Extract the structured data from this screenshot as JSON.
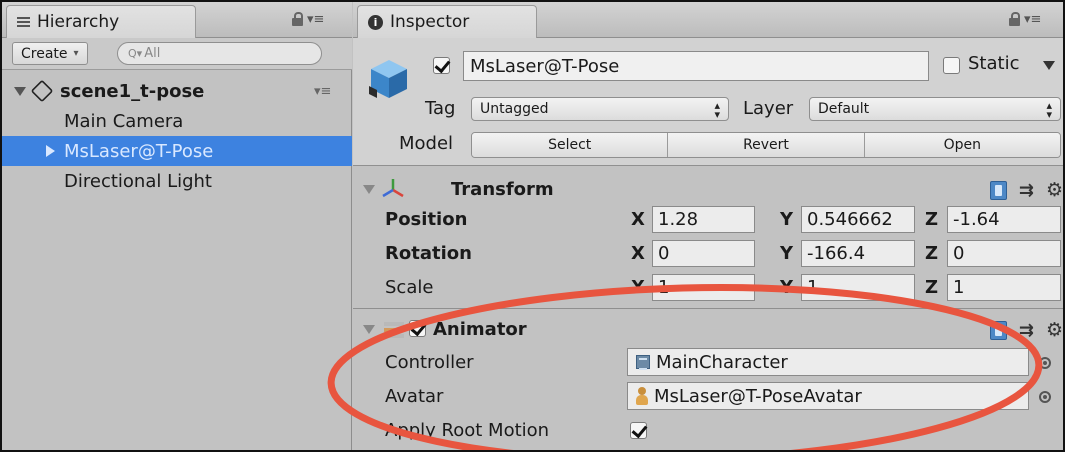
{
  "hierarchy": {
    "tab_label": "Hierarchy",
    "create_label": "Create",
    "search_placeholder": "All",
    "scene_name": "scene1_t-pose",
    "items": [
      "Main Camera",
      "MsLaser@T-Pose",
      "Directional Light"
    ],
    "selected_item": "MsLaser@T-Pose"
  },
  "inspector": {
    "tab_label": "Inspector",
    "object_name": "MsLaser@T-Pose",
    "active": true,
    "static_label": "Static",
    "static": false,
    "tag_label": "Tag",
    "tag_value": "Untagged",
    "layer_label": "Layer",
    "layer_value": "Default",
    "model_label": "Model",
    "model_buttons": [
      "Select",
      "Revert",
      "Open"
    ]
  },
  "transform": {
    "title": "Transform",
    "position_label": "Position",
    "rotation_label": "Rotation",
    "scale_label": "Scale",
    "axis_x": "X",
    "axis_y": "Y",
    "axis_z": "Z",
    "position": {
      "x": "1.28",
      "y": "0.546662",
      "z": "-1.64"
    },
    "rotation": {
      "x": "0",
      "y": "-166.4",
      "z": "0"
    },
    "scale": {
      "x": "1",
      "y": "1",
      "z": "1"
    }
  },
  "animator": {
    "title": "Animator",
    "enabled": true,
    "controller_label": "Controller",
    "controller_value": "MainCharacter",
    "avatar_label": "Avatar",
    "avatar_value": "MsLaser@T-PoseAvatar",
    "apply_root_motion_label": "Apply Root Motion",
    "apply_root_motion": true
  },
  "annotation": {
    "ellipse_color": "#e8553f"
  },
  "colors": {
    "selection": "#3d82e0",
    "panel_bg": "#c2c2c2"
  }
}
